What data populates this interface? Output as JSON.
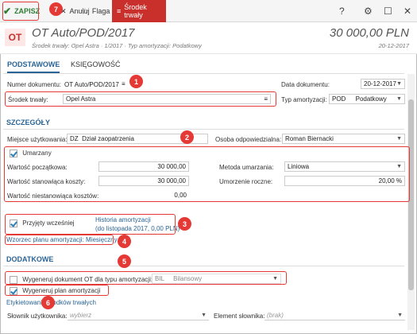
{
  "toolbar": {
    "save_label": "ZAPISZ",
    "cancel_label": "Anuluj",
    "flag_label": "Flaga",
    "asset_label": "Środek trwały"
  },
  "header": {
    "badge": "OT",
    "title": "OT Auto/POD/2017",
    "subtitle": "Środek trwały: Opel Astra  ·  1/2017  ·  Typ amortyzacji: Podatkowy",
    "amount": "30 000,00 PLN",
    "date": "20-12-2017"
  },
  "tabs": [
    "PODSTAWOWE",
    "KSIĘGOWOŚĆ"
  ],
  "basic": {
    "doc_number_label": "Numer dokumentu:",
    "doc_number_value": "OT Auto/POD/2017",
    "asset_label": "Środek trwały:",
    "asset_value": "Opel Astra",
    "doc_date_label": "Data dokumentu:",
    "doc_date_value": "20-12-2017",
    "amort_type_label": "Typ amortyzacji:",
    "amort_type_code": "POD",
    "amort_type_value": "Podatkowy"
  },
  "details": {
    "section": "SZCZEGÓŁY",
    "place_label": "Miejsce użytkowania:",
    "place_code": "DZ",
    "place_value": "Dział zaopatrzenia",
    "person_label": "Osoba odpowiedzialna:",
    "person_value": "Roman Biernacki",
    "retired_label": "Umarzany",
    "initial_label": "Wartość początkowa:",
    "initial_value": "30 000,00",
    "method_label": "Metoda umarzania:",
    "method_value": "Liniowa",
    "base_label": "Wartość stanowiąca koszty:",
    "base_value": "30 000,00",
    "annual_label": "Umorzenie roczne:",
    "annual_value": "20,00 %",
    "noncost_label": "Wartość niestanowiąca kosztów:",
    "noncost_value": "0,00",
    "accepted_label": "Przyjęty wcześniej",
    "history_line1": "Historia amortyzacji",
    "history_line2": "(do listopada 2017, 0,00 PLN)",
    "plan_template": "Wzorzec planu amortyzacji: Miesięczny"
  },
  "additional": {
    "section": "DODATKOWE",
    "gen_ot_label": "Wygeneruj dokument OT dla typu amortyzacji:",
    "gen_ot_code": "BIL",
    "gen_ot_value": "Bilansowy",
    "gen_plan_label": "Wygeneruj plan amortyzacji",
    "labels_link": "Etykietowanie środków trwałych",
    "user_dict_label": "Słownik użytkownika:",
    "user_dict_placeholder": "wybierz",
    "other_dict_label": "Element słownika:",
    "other_dict_placeholder": "(brak)"
  },
  "annotations": [
    "1",
    "2",
    "3",
    "4",
    "5",
    "6",
    "7"
  ],
  "colors": {
    "accent": "#2a6496",
    "danger": "#c9302c",
    "highlight": "#e53935"
  }
}
